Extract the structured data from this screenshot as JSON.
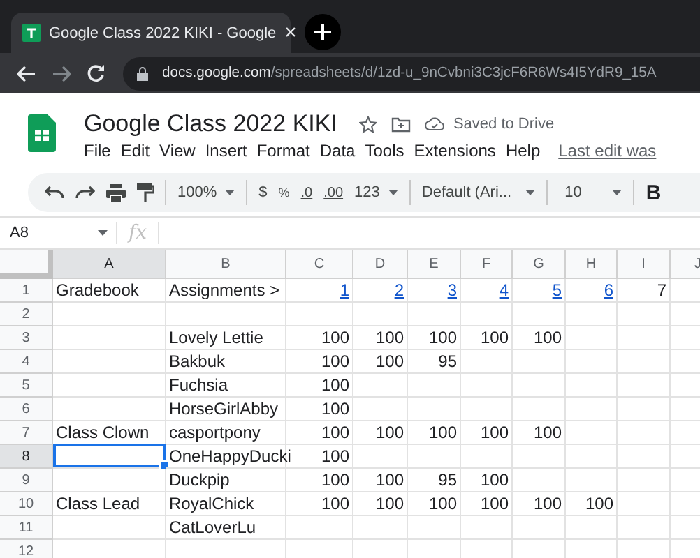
{
  "browser": {
    "tab": {
      "title": "Google Class 2022 KIKI - Google",
      "close": "×"
    },
    "url": {
      "host": "docs.google.com",
      "path": "/spreadsheets/d/1zd-u_9nCvbni3C3jcF6R6Ws4I5YdR9_15A"
    }
  },
  "app": {
    "title": "Google Class 2022 KIKI",
    "status": "Saved to Drive",
    "menus": [
      "File",
      "Edit",
      "View",
      "Insert",
      "Format",
      "Data",
      "Tools",
      "Extensions",
      "Help"
    ],
    "last_edit": "Last edit was"
  },
  "toolbar": {
    "zoom": "100%",
    "currency": "$",
    "percent": "%",
    "decrease_decimal": ".0",
    "increase_decimal": ".00",
    "more_formats": "123",
    "font": "Default (Ari...",
    "font_size": "10",
    "bold": "B"
  },
  "formula_bar": {
    "cell_ref": "A8",
    "fx": "fx"
  },
  "grid": {
    "columns": [
      {
        "label": "A",
        "selected": true
      },
      {
        "label": "B",
        "selected": false
      },
      {
        "label": "C",
        "selected": false
      },
      {
        "label": "D",
        "selected": false
      },
      {
        "label": "E",
        "selected": false
      },
      {
        "label": "F",
        "selected": false
      },
      {
        "label": "G",
        "selected": false
      },
      {
        "label": "H",
        "selected": false
      },
      {
        "label": "I",
        "selected": false
      },
      {
        "label": "J",
        "selected": false
      }
    ],
    "rows": [
      {
        "number": "1",
        "selected": false,
        "cells": [
          {
            "text": "Gradebook",
            "kind": "text"
          },
          {
            "text": "Assignments >",
            "kind": "text"
          },
          {
            "text": "1",
            "kind": "link"
          },
          {
            "text": "2",
            "kind": "link"
          },
          {
            "text": "3",
            "kind": "link"
          },
          {
            "text": "4",
            "kind": "link"
          },
          {
            "text": "5",
            "kind": "link"
          },
          {
            "text": "6",
            "kind": "link"
          },
          {
            "text": "7",
            "kind": "number"
          },
          null
        ]
      },
      {
        "number": "2",
        "selected": false,
        "cells": [
          null,
          null,
          null,
          null,
          null,
          null,
          null,
          null,
          null,
          null
        ]
      },
      {
        "number": "3",
        "selected": false,
        "cells": [
          null,
          {
            "text": "Lovely Lettie",
            "kind": "text"
          },
          {
            "text": "100",
            "kind": "number"
          },
          {
            "text": "100",
            "kind": "number"
          },
          {
            "text": "100",
            "kind": "number"
          },
          {
            "text": "100",
            "kind": "number"
          },
          {
            "text": "100",
            "kind": "number"
          },
          null,
          null,
          null
        ]
      },
      {
        "number": "4",
        "selected": false,
        "cells": [
          null,
          {
            "text": "Bakbuk",
            "kind": "text"
          },
          {
            "text": "100",
            "kind": "number"
          },
          {
            "text": "100",
            "kind": "number"
          },
          {
            "text": "95",
            "kind": "number"
          },
          null,
          null,
          null,
          null,
          null
        ]
      },
      {
        "number": "5",
        "selected": false,
        "cells": [
          null,
          {
            "text": "Fuchsia",
            "kind": "text"
          },
          {
            "text": "100",
            "kind": "number"
          },
          null,
          null,
          null,
          null,
          null,
          null,
          null
        ]
      },
      {
        "number": "6",
        "selected": false,
        "cells": [
          null,
          {
            "text": "HorseGirlAbby",
            "kind": "text"
          },
          {
            "text": "100",
            "kind": "number"
          },
          null,
          null,
          null,
          null,
          null,
          null,
          null
        ]
      },
      {
        "number": "7",
        "selected": false,
        "cells": [
          {
            "text": "Class Clown",
            "kind": "text"
          },
          {
            "text": "casportpony",
            "kind": "text"
          },
          {
            "text": "100",
            "kind": "number"
          },
          {
            "text": "100",
            "kind": "number"
          },
          {
            "text": "100",
            "kind": "number"
          },
          {
            "text": "100",
            "kind": "number"
          },
          {
            "text": "100",
            "kind": "number"
          },
          null,
          null,
          null
        ]
      },
      {
        "number": "8",
        "selected": true,
        "cells": [
          null,
          {
            "text": "OneHappyDucki",
            "kind": "text"
          },
          {
            "text": "100",
            "kind": "number"
          },
          null,
          null,
          null,
          null,
          null,
          null,
          null
        ]
      },
      {
        "number": "9",
        "selected": false,
        "cells": [
          null,
          {
            "text": "Duckpip",
            "kind": "text"
          },
          {
            "text": "100",
            "kind": "number"
          },
          {
            "text": "100",
            "kind": "number"
          },
          {
            "text": "95",
            "kind": "number"
          },
          {
            "text": "100",
            "kind": "number"
          },
          null,
          null,
          null,
          null
        ]
      },
      {
        "number": "10",
        "selected": false,
        "cells": [
          {
            "text": "Class Lead",
            "kind": "text"
          },
          {
            "text": "RoyalChick",
            "kind": "text"
          },
          {
            "text": "100",
            "kind": "number"
          },
          {
            "text": "100",
            "kind": "number"
          },
          {
            "text": "100",
            "kind": "number"
          },
          {
            "text": "100",
            "kind": "number"
          },
          {
            "text": "100",
            "kind": "number"
          },
          {
            "text": "100",
            "kind": "number"
          },
          null,
          null
        ]
      },
      {
        "number": "11",
        "selected": false,
        "cells": [
          null,
          {
            "text": "CatLoverLu",
            "kind": "text"
          },
          null,
          null,
          null,
          null,
          null,
          null,
          null,
          null
        ]
      },
      {
        "number": "12",
        "selected": false,
        "cells": [
          null,
          null,
          null,
          null,
          null,
          null,
          null,
          null,
          null,
          null
        ]
      }
    ]
  }
}
